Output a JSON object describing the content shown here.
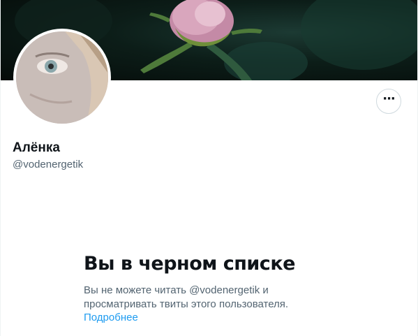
{
  "profile": {
    "display_name": "Алёнка",
    "username": "@vodenergetik",
    "more_icon": "more-horizontal-icon"
  },
  "blocked": {
    "title": "Вы в черном списке",
    "message": "Вы не можете читать @vodenergetik и просматривать твиты этого пользователя.",
    "learn_more": "Подробнее"
  },
  "colors": {
    "text_primary": "#0f1419",
    "text_secondary": "#536471",
    "link": "#1d9bf0",
    "border": "#cfd9de"
  }
}
